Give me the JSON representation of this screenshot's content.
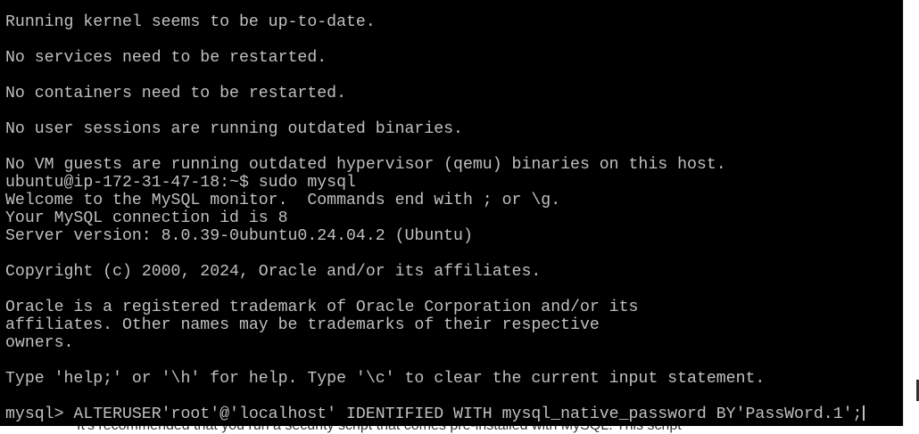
{
  "terminal": {
    "lines": [
      "Running kernel seems to be up-to-date.",
      "",
      "No services need to be restarted.",
      "",
      "No containers need to be restarted.",
      "",
      "No user sessions are running outdated binaries.",
      "",
      "No VM guests are running outdated hypervisor (qemu) binaries on this host.",
      "ubuntu@ip-172-31-47-18:~$ sudo mysql",
      "Welcome to the MySQL monitor.  Commands end with ; or \\g.",
      "Your MySQL connection id is 8",
      "Server version: 8.0.39-0ubuntu0.24.04.2 (Ubuntu)",
      "",
      "Copyright (c) 2000, 2024, Oracle and/or its affiliates.",
      "",
      "Oracle is a registered trademark of Oracle Corporation and/or its",
      "affiliates. Other names may be trademarks of their respective",
      "owners.",
      "",
      "Type 'help;' or '\\h' for help. Type '\\c' to clear the current input statement.",
      "",
      "mysql> ALTERUSER'root'@'localhost' IDENTIFIED WITH mysql_native_password BY'PassWord.1';"
    ],
    "colors": {
      "background": "#000000",
      "foreground": "#c0c0c0"
    }
  },
  "page_below": {
    "partial_text": "It's recommended that you run a security script that comes pre-installed with MySQL. This script"
  }
}
